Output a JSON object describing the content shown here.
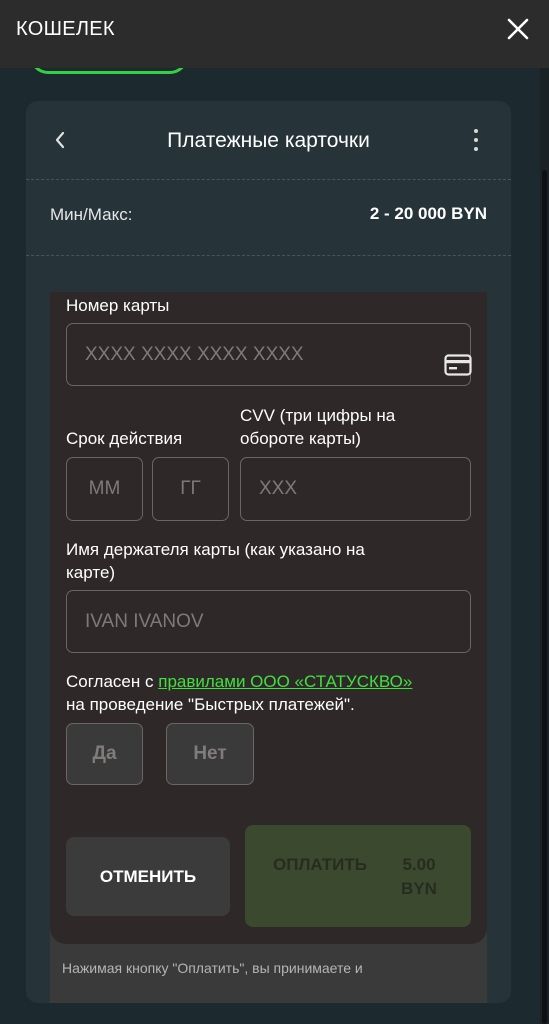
{
  "topbar": {
    "title": "КОШЕЛЕК"
  },
  "panel": {
    "title": "Платежные карточки",
    "limits": {
      "label": "Мин/Макс:",
      "value": "2 - 20 000 BYN"
    }
  },
  "form": {
    "card_number": {
      "label": "Номер карты",
      "placeholder": "XXXX XXXX XXXX XXXX"
    },
    "expiry": {
      "label": "Срок действия",
      "month_placeholder": "MM",
      "year_placeholder": "ГГ"
    },
    "cvv": {
      "label_line1": "CVV (три цифры на",
      "label_line2": "обороте карты)",
      "placeholder": "XXX"
    },
    "holder": {
      "label_line1": "Имя держателя карты (как указано на",
      "label_line2": "карте)",
      "placeholder": "IVAN IVANOV"
    },
    "agreement": {
      "prefix": "Согласен с ",
      "link": "правилами ООО «СТАТУСКВО»",
      "suffix": "на проведение \"Быстрых платежей\".",
      "yes": "Да",
      "no": "Нет"
    },
    "cancel_label": "ОТМЕНИТЬ",
    "pay_label": "ОПЛАТИТЬ",
    "pay_amount_line1": "5.00",
    "pay_amount_line2": "BYN"
  },
  "note": "Нажимая кнопку \"Оплатить\", вы принимаете и",
  "colors": {
    "accent_green": "#3fe03f",
    "panel_bg": "#26343a",
    "form_bg": "#2e2928"
  }
}
